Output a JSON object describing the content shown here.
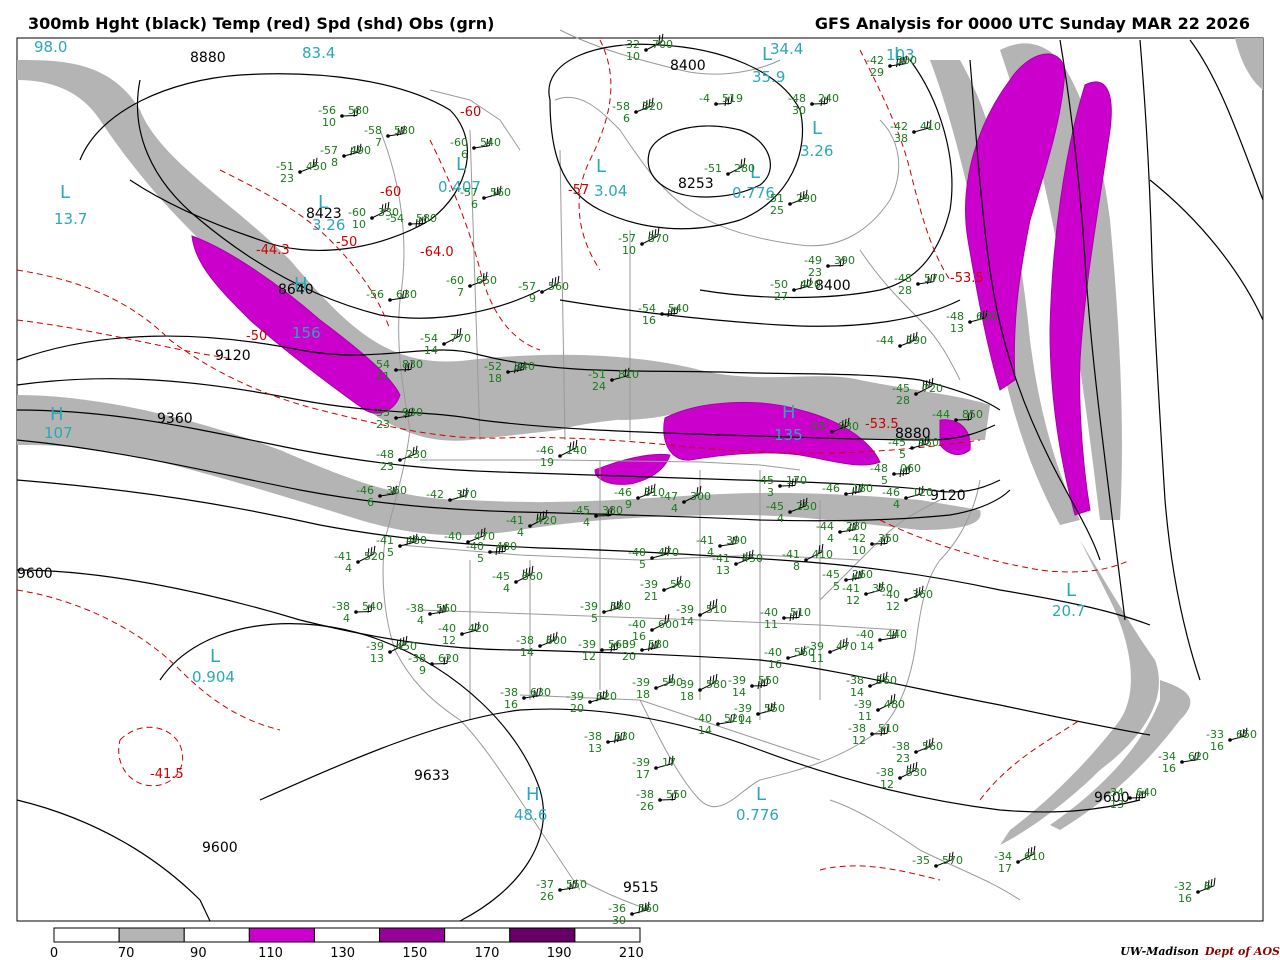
{
  "title_left": "300mb Hght (black) Temp (red) Spd (shd) Obs (grn)",
  "title_right": "GFS Analysis for 0000 UTC Sunday  MAR 22 2026",
  "credit": {
    "org": "UW-Madison",
    "dept": "Dept of AOS"
  },
  "colors": {
    "height_contour": "#000000",
    "temp_contour": "#cc0000",
    "obs": "#1a7a1a",
    "pressure_labels": "#2aa8b8",
    "speed_70_90": "#b4b4b4",
    "speed_110_130": "#cc00cc",
    "speed_150_170": "#99009a",
    "speed_190_210": "#660066"
  },
  "legend": {
    "ticks": [
      "0",
      "70",
      "90",
      "110",
      "130",
      "150",
      "170",
      "190",
      "210"
    ],
    "fills": [
      "#ffffff",
      "#b4b4b4",
      "#ffffff",
      "#cc00cc",
      "#ffffff",
      "#99009a",
      "#ffffff",
      "#660066",
      "#ffffff"
    ]
  },
  "height_labels": [
    "8880",
    "8423",
    "8640",
    "9120",
    "9360",
    "8400",
    "8253",
    "8400",
    "8880",
    "9120",
    "9600",
    "9633",
    "9600",
    "9515",
    "9600"
  ],
  "temp_labels": [
    "-44.3",
    "-50",
    "-64.0",
    "-60",
    "-50",
    "-53.5",
    "-41.5",
    "-60",
    "-57",
    "-53.5"
  ],
  "cyan_labels": [
    {
      "sym": "L",
      "val": "13.7"
    },
    {
      "sym": "L",
      "val": "0.407"
    },
    {
      "sym": "L",
      "val": "3.26"
    },
    {
      "sym": "L",
      "val": "3.04"
    },
    {
      "sym": "L",
      "val": "0.776"
    },
    {
      "sym": "L",
      "val": "3.26"
    },
    {
      "sym": "L",
      "val": "35.9"
    },
    {
      "sym": "L",
      "val": "34.4"
    },
    {
      "sym": "L",
      "val": "20.7"
    },
    {
      "sym": "L",
      "val": "0.904"
    },
    {
      "sym": "L",
      "val": "0.776"
    },
    {
      "sym": "H",
      "val": "48.6"
    },
    {
      "sym": "H",
      "val": "107"
    },
    {
      "sym": "H",
      "val": "135"
    },
    {
      "sym": "H",
      "val": "156"
    },
    {
      "sym": "L",
      "val": "103"
    },
    {
      "sym": "",
      "val": "98.0"
    },
    {
      "sym": "",
      "val": "83.4"
    }
  ],
  "obs": [
    {
      "t": "-56",
      "h": "580",
      "d": "10"
    },
    {
      "t": "-58",
      "h": "580",
      "d": "7"
    },
    {
      "t": "-57",
      "h": "490",
      "d": "8"
    },
    {
      "t": "-51",
      "h": "450",
      "d": "23"
    },
    {
      "t": "-60",
      "h": "330",
      "d": "10"
    },
    {
      "t": "-54",
      "h": "580",
      "d": ""
    },
    {
      "t": "-60",
      "h": "540",
      "d": "6"
    },
    {
      "t": "-57",
      "h": "560",
      "d": "6"
    },
    {
      "t": "-58",
      "h": "320",
      "d": "6"
    },
    {
      "t": "-51",
      "h": "280",
      "d": ""
    },
    {
      "t": "-48",
      "h": "240",
      "d": "30"
    },
    {
      "t": "-42",
      "h": "300",
      "d": "29"
    },
    {
      "t": "-42",
      "h": "410",
      "d": "38"
    },
    {
      "t": "-51",
      "h": "290",
      "d": "25"
    },
    {
      "t": "-57",
      "h": "370",
      "d": "10"
    },
    {
      "t": "-49",
      "h": "390",
      "d": "23"
    },
    {
      "t": "-48",
      "h": "570",
      "d": "28"
    },
    {
      "t": "-50",
      "h": "420",
      "d": "27"
    },
    {
      "t": "-60",
      "h": "650",
      "d": "7"
    },
    {
      "t": "-57",
      "h": "560",
      "d": "9"
    },
    {
      "t": "-54",
      "h": "540",
      "d": "16"
    },
    {
      "t": "-56",
      "h": "630",
      "d": ""
    },
    {
      "t": "-48",
      "h": "620",
      "d": "13"
    },
    {
      "t": "-44",
      "h": "590",
      "d": ""
    },
    {
      "t": "-54",
      "h": "770",
      "d": "14"
    },
    {
      "t": "-54",
      "h": "830",
      "d": "11"
    },
    {
      "t": "-52",
      "h": "840",
      "d": "18"
    },
    {
      "t": "-51",
      "h": "810",
      "d": "24"
    },
    {
      "t": "-55",
      "h": "930",
      "d": ""
    },
    {
      "t": "-45",
      "h": "720",
      "d": "28"
    },
    {
      "t": "-44",
      "h": "850",
      "d": ""
    },
    {
      "t": "-53",
      "h": "930",
      "d": "23"
    },
    {
      "t": "-45",
      "h": "930",
      "d": "5"
    },
    {
      "t": "-48",
      "h": "230",
      "d": "23"
    },
    {
      "t": "-46",
      "h": "140",
      "d": "19"
    },
    {
      "t": "-48",
      "h": "060",
      "d": "5"
    },
    {
      "t": "-46",
      "h": "360",
      "d": "6"
    },
    {
      "t": "-42",
      "h": "370",
      "d": ""
    },
    {
      "t": "-46",
      "h": "310",
      "d": "9"
    },
    {
      "t": "-47",
      "h": "300",
      "d": "4"
    },
    {
      "t": "-45",
      "h": "170",
      "d": "3"
    },
    {
      "t": "-46",
      "h": "180",
      "d": ""
    },
    {
      "t": "-46",
      "h": "120",
      "d": "4"
    },
    {
      "t": "-45",
      "h": "250",
      "d": "4"
    },
    {
      "t": "-41",
      "h": "420",
      "d": "4"
    },
    {
      "t": "-45",
      "h": "380",
      "d": "4"
    },
    {
      "t": "-44",
      "h": "280",
      "d": "4"
    },
    {
      "t": "-41",
      "h": "480",
      "d": "5"
    },
    {
      "t": "-40",
      "h": "470",
      "d": ""
    },
    {
      "t": "-41",
      "h": "520",
      "d": "4"
    },
    {
      "t": "-40",
      "h": "480",
      "d": "5"
    },
    {
      "t": "-41",
      "h": "390",
      "d": "4"
    },
    {
      "t": "-40",
      "h": "470",
      "d": "5"
    },
    {
      "t": "-41",
      "h": "450",
      "d": "13"
    },
    {
      "t": "-41",
      "h": "410",
      "d": "8"
    },
    {
      "t": "-42",
      "h": "350",
      "d": "10"
    },
    {
      "t": "-45",
      "h": "260",
      "d": "5"
    },
    {
      "t": "-41",
      "h": "350",
      "d": "12"
    },
    {
      "t": "-40",
      "h": "360",
      "d": "12"
    },
    {
      "t": "-45",
      "h": "360",
      "d": "4"
    },
    {
      "t": "-38",
      "h": "540",
      "d": "4"
    },
    {
      "t": "-38",
      "h": "560",
      "d": "4"
    },
    {
      "t": "-39",
      "h": "580",
      "d": "5"
    },
    {
      "t": "-39",
      "h": "560",
      "d": "21"
    },
    {
      "t": "-39",
      "h": "510",
      "d": "14"
    },
    {
      "t": "-40",
      "h": "510",
      "d": "11"
    },
    {
      "t": "-40",
      "h": "440",
      "d": "14"
    },
    {
      "t": "-40",
      "h": "420",
      "d": "12"
    },
    {
      "t": "-38",
      "h": "600",
      "d": "14"
    },
    {
      "t": "-40",
      "h": "600",
      "d": "16"
    },
    {
      "t": "-39",
      "h": "560",
      "d": "12"
    },
    {
      "t": "-39",
      "h": "580",
      "d": "20"
    },
    {
      "t": "-40",
      "h": "560",
      "d": "16"
    },
    {
      "t": "-39",
      "h": "470",
      "d": "11"
    },
    {
      "t": "-39",
      "h": "450",
      "d": "13"
    },
    {
      "t": "-38",
      "h": "620",
      "d": "9"
    },
    {
      "t": "-38",
      "h": "630",
      "d": "16"
    },
    {
      "t": "-39",
      "h": "620",
      "d": "20"
    },
    {
      "t": "-39",
      "h": "590",
      "d": "18"
    },
    {
      "t": "-39",
      "h": "580",
      "d": "18"
    },
    {
      "t": "-39",
      "h": "550",
      "d": "14"
    },
    {
      "t": "-40",
      "h": "520",
      "d": "14"
    },
    {
      "t": "-39",
      "h": "550",
      "d": "14"
    },
    {
      "t": "-38",
      "h": "560",
      "d": "14"
    },
    {
      "t": "-39",
      "h": "480",
      "d": "11"
    },
    {
      "t": "-38",
      "h": "510",
      "d": "12"
    },
    {
      "t": "-38",
      "h": "530",
      "d": "13"
    },
    {
      "t": "-39",
      "h": "17",
      "d": "17"
    },
    {
      "t": "-38",
      "h": "560",
      "d": "23"
    },
    {
      "t": "-38",
      "h": "530",
      "d": "12"
    },
    {
      "t": "-38",
      "h": "550",
      "d": "26"
    },
    {
      "t": "-37",
      "h": "550",
      "d": "26"
    },
    {
      "t": "-36",
      "h": "560",
      "d": "30"
    },
    {
      "t": "-35",
      "h": "570",
      "d": ""
    },
    {
      "t": "-34",
      "h": "610",
      "d": "17"
    },
    {
      "t": "-34",
      "h": "640",
      "d": "13"
    },
    {
      "t": "-34",
      "h": "620",
      "d": "16"
    },
    {
      "t": "-33",
      "h": "650",
      "d": "16"
    },
    {
      "t": "-32",
      "h": "6",
      "d": "16"
    },
    {
      "t": "-32",
      "h": "700",
      "d": "10"
    },
    {
      "t": "-4",
      "h": "519",
      "d": ""
    },
    {
      "t": "-60",
      "h": "",
      "d": ""
    }
  ]
}
